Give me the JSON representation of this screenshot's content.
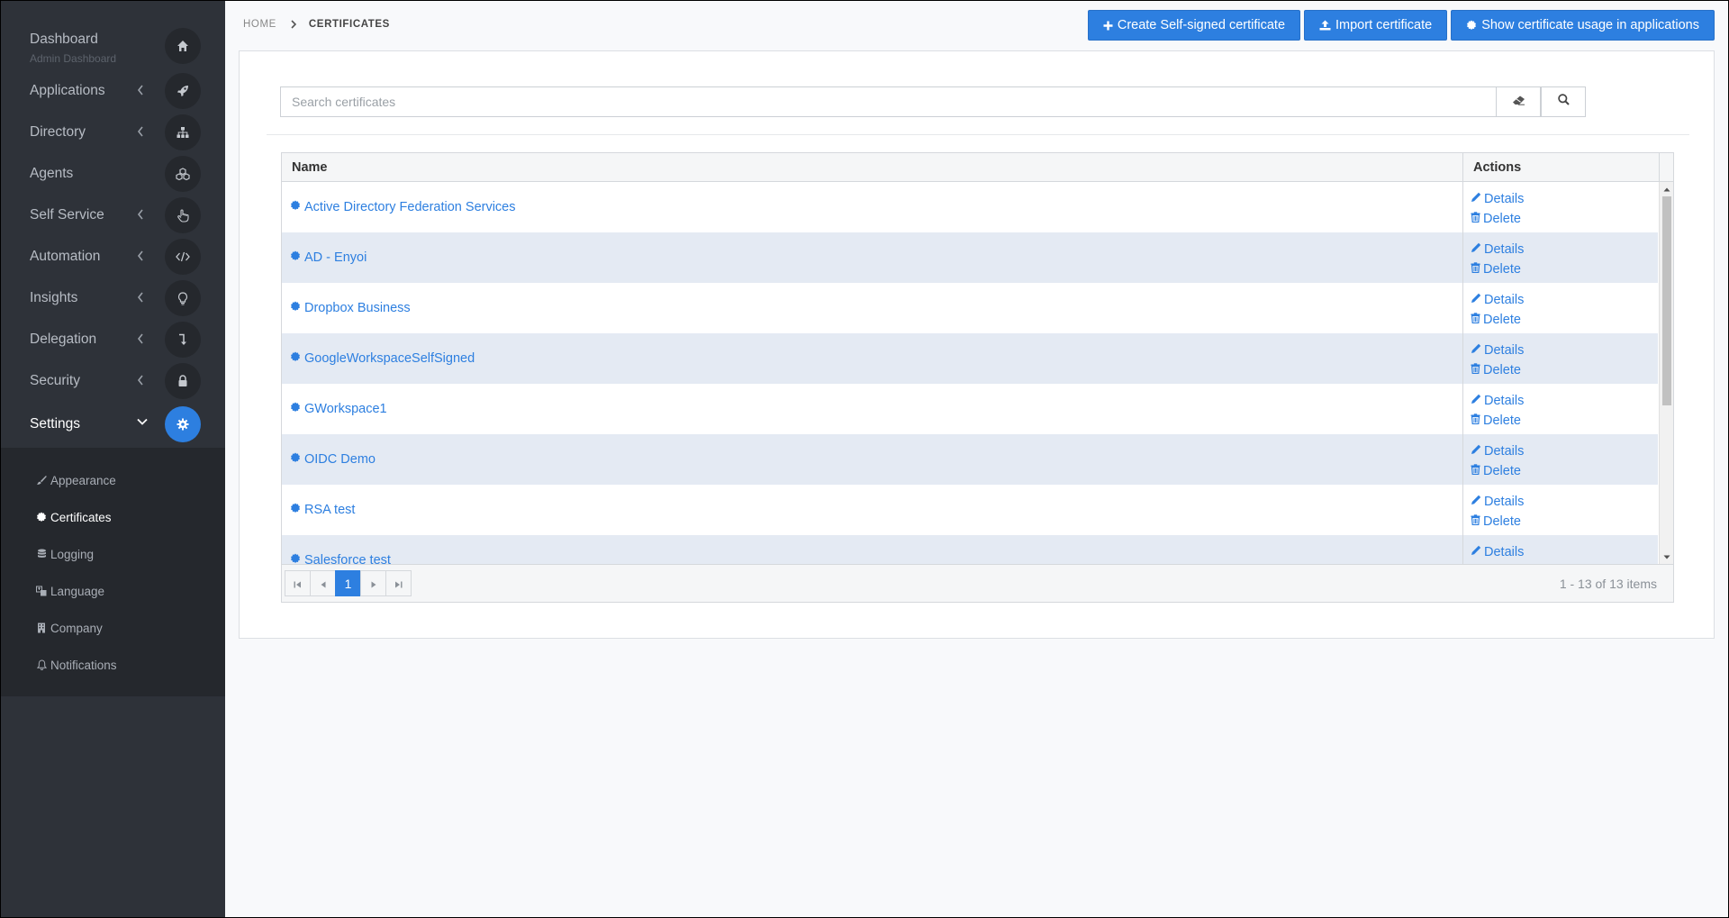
{
  "sidebar": {
    "items": [
      {
        "label": "Dashboard",
        "sub": "Admin Dashboard",
        "icon": "home-icon",
        "chevron": false
      },
      {
        "label": "Applications",
        "icon": "rocket-icon",
        "chevron": true
      },
      {
        "label": "Directory",
        "icon": "sitemap-icon",
        "chevron": true
      },
      {
        "label": "Agents",
        "icon": "cubes-icon",
        "chevron": false
      },
      {
        "label": "Self Service",
        "icon": "hand-pointer-icon",
        "chevron": true
      },
      {
        "label": "Automation",
        "icon": "code-icon",
        "chevron": true
      },
      {
        "label": "Insights",
        "icon": "lightbulb-icon",
        "chevron": true
      },
      {
        "label": "Delegation",
        "icon": "level-down-icon",
        "chevron": true
      },
      {
        "label": "Security",
        "icon": "lock-icon",
        "chevron": true
      },
      {
        "label": "Settings",
        "icon": "gear-icon",
        "chevron": true,
        "expanded": true
      }
    ],
    "subitems": [
      {
        "label": "Appearance",
        "icon": "paintbrush-icon"
      },
      {
        "label": "Certificates",
        "icon": "certificate-icon",
        "active": true
      },
      {
        "label": "Logging",
        "icon": "database-icon"
      },
      {
        "label": "Language",
        "icon": "language-icon"
      },
      {
        "label": "Company",
        "icon": "building-icon"
      },
      {
        "label": "Notifications",
        "icon": "bell-icon"
      }
    ]
  },
  "breadcrumb": {
    "home": "HOME",
    "current": "CERTIFICATES"
  },
  "toolbar": {
    "create_label": "Create Self-signed certificate",
    "import_label": "Import certificate",
    "usage_label": "Show certificate usage in applications"
  },
  "search": {
    "placeholder": "Search certificates",
    "value": ""
  },
  "grid": {
    "columns": {
      "name": "Name",
      "actions": "Actions"
    },
    "rows": [
      {
        "name": "Active Directory Federation Services"
      },
      {
        "name": "AD - Enyoi"
      },
      {
        "name": "Dropbox Business"
      },
      {
        "name": "GoogleWorkspaceSelfSigned"
      },
      {
        "name": "GWorkspace1"
      },
      {
        "name": "OIDC Demo"
      },
      {
        "name": "RSA test"
      },
      {
        "name": "Salesforce test"
      }
    ],
    "details_label": "Details",
    "delete_label": "Delete"
  },
  "pager": {
    "current_page": "1",
    "info": "1 - 13 of 13 items"
  },
  "colors": {
    "accent": "#2d7fe0",
    "sidebar": "#2e3239",
    "sidebar_dark": "#25282d",
    "row_alt": "#e4eaf3"
  }
}
